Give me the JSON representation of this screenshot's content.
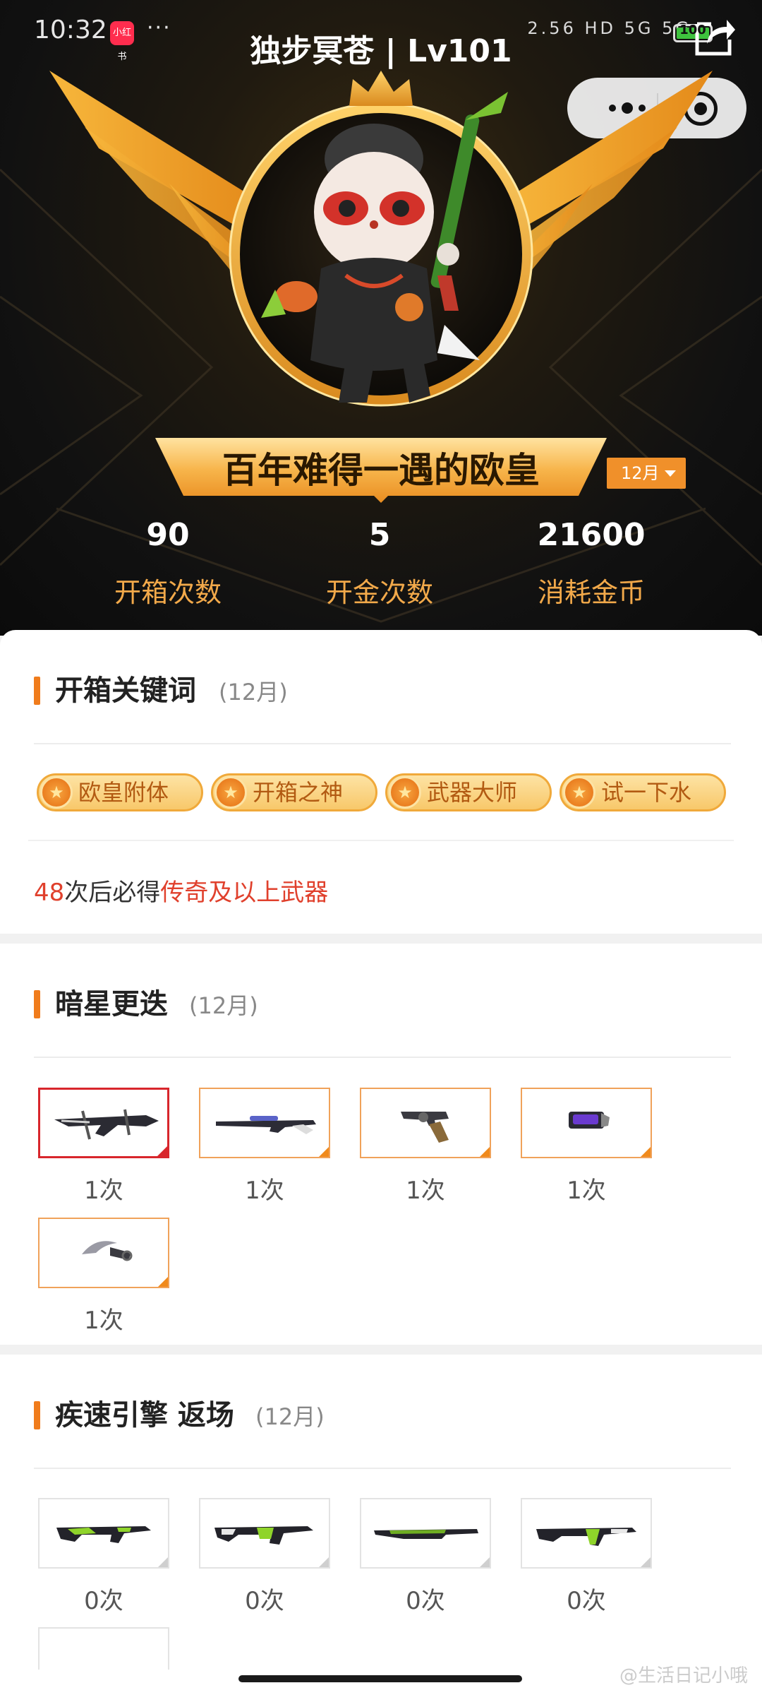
{
  "status_bar": {
    "time": "10:32",
    "app_badge": "小红书",
    "dots": "···",
    "icons": "2.56  HD 5G 5G",
    "battery": "100"
  },
  "header": {
    "title": "独步冥苍 | Lv101"
  },
  "profile": {
    "rank_title": "百年难得一遇的欧皇",
    "month_select": "12月",
    "stats": [
      {
        "value": "90",
        "label": "开箱次数"
      },
      {
        "value": "5",
        "label": "开金次数"
      },
      {
        "value": "21600",
        "label": "消耗金币"
      }
    ]
  },
  "keywords_section": {
    "title": "开箱关键词",
    "month": "(12月)",
    "keywords": [
      "欧皇附体",
      "开箱之神",
      "武器大师",
      "试一下水"
    ],
    "guarantee": {
      "count": "48",
      "middle": "次后必得",
      "highlight": "传奇及以上武器"
    }
  },
  "section_dark_star": {
    "title": "暗星更迭",
    "month": "(12月)",
    "items": [
      {
        "count": "1次",
        "icon": "crossbow-icon"
      },
      {
        "count": "1次",
        "icon": "sniper-rifle-icon"
      },
      {
        "count": "1次",
        "icon": "revolver-icon"
      },
      {
        "count": "1次",
        "icon": "gauntlet-icon"
      },
      {
        "count": "1次",
        "icon": "karambit-knife-icon"
      }
    ]
  },
  "section_speed_engine": {
    "title": "疾速引擎 返场",
    "month": "(12月)",
    "items": [
      {
        "count": "0次",
        "icon": "assault-rifle-icon"
      },
      {
        "count": "0次",
        "icon": "assault-rifle-icon"
      },
      {
        "count": "0次",
        "icon": "rifle-icon"
      },
      {
        "count": "0次",
        "icon": "assault-rifle-icon"
      }
    ]
  },
  "watermark": "@生活日记小哦"
}
